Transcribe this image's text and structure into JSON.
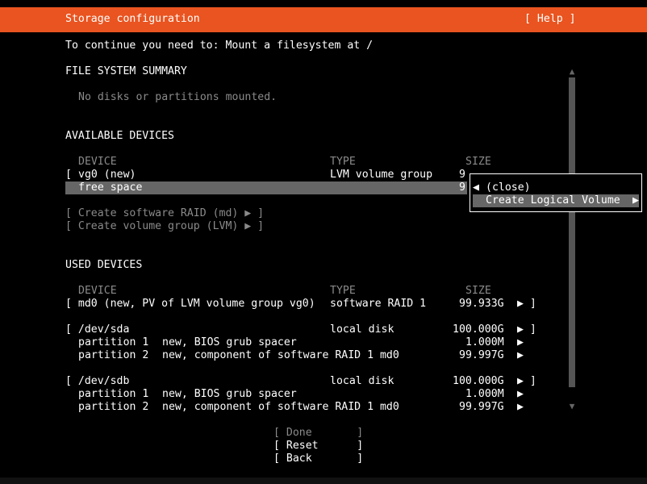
{
  "header": {
    "title": "Storage configuration",
    "help": "[ Help ]"
  },
  "instruction": "To continue you need to: Mount a filesystem at /",
  "fs_summary": {
    "heading": "FILE SYSTEM SUMMARY",
    "empty": "No disks or partitions mounted."
  },
  "available": {
    "heading": "AVAILABLE DEVICES",
    "columns": {
      "device": "DEVICE",
      "type": "TYPE",
      "size": "SIZE"
    },
    "vg0": {
      "bracket": "[",
      "device": "vg0 (new)",
      "type": "LVM volume group",
      "size": "9"
    },
    "free": {
      "device": "free space",
      "size": "9"
    },
    "create_raid": "[ Create software RAID (md) ▶ ]",
    "create_vg": "[ Create volume group (LVM) ▶ ]"
  },
  "popup": {
    "close": "(close)",
    "create_lv": "Create Logical Volume",
    "left_arrow": "◀",
    "right_arrow": "▶"
  },
  "used": {
    "heading": "USED DEVICES",
    "columns": {
      "device": "DEVICE",
      "type": "TYPE",
      "size": "SIZE"
    },
    "md0": {
      "device": "[ md0 (new, PV of LVM volume group vg0)",
      "type": "software RAID 1",
      "size": "99.933G",
      "action": "▶ ]"
    },
    "sda": {
      "device": "[ /dev/sda",
      "type": "local disk",
      "size": "100.000G",
      "action": "▶ ]",
      "p1": {
        "name": "partition 1",
        "desc": "new, BIOS grub spacer",
        "size": "1.000M",
        "action": "▶"
      },
      "p2": {
        "name": "partition 2",
        "desc": "new, component of software RAID 1 md0",
        "size": "99.997G",
        "action": "▶"
      }
    },
    "sdb": {
      "device": "[ /dev/sdb",
      "type": "local disk",
      "size": "100.000G",
      "action": "▶ ]",
      "p1": {
        "name": "partition 1",
        "desc": "new, BIOS grub spacer",
        "size": "1.000M",
        "action": "▶"
      },
      "p2": {
        "name": "partition 2",
        "desc": "new, component of software RAID 1 md0",
        "size": "99.997G",
        "action": "▶"
      }
    }
  },
  "buttons": {
    "done": "[ Done       ]",
    "reset": "[ Reset      ]",
    "back": "[ Back       ]"
  },
  "scroll": {
    "up": "▲",
    "down": "▼"
  },
  "colors": {
    "accent": "#e95420",
    "selection": "#666666",
    "dim": "#8a8a8a",
    "background": "#000000"
  }
}
